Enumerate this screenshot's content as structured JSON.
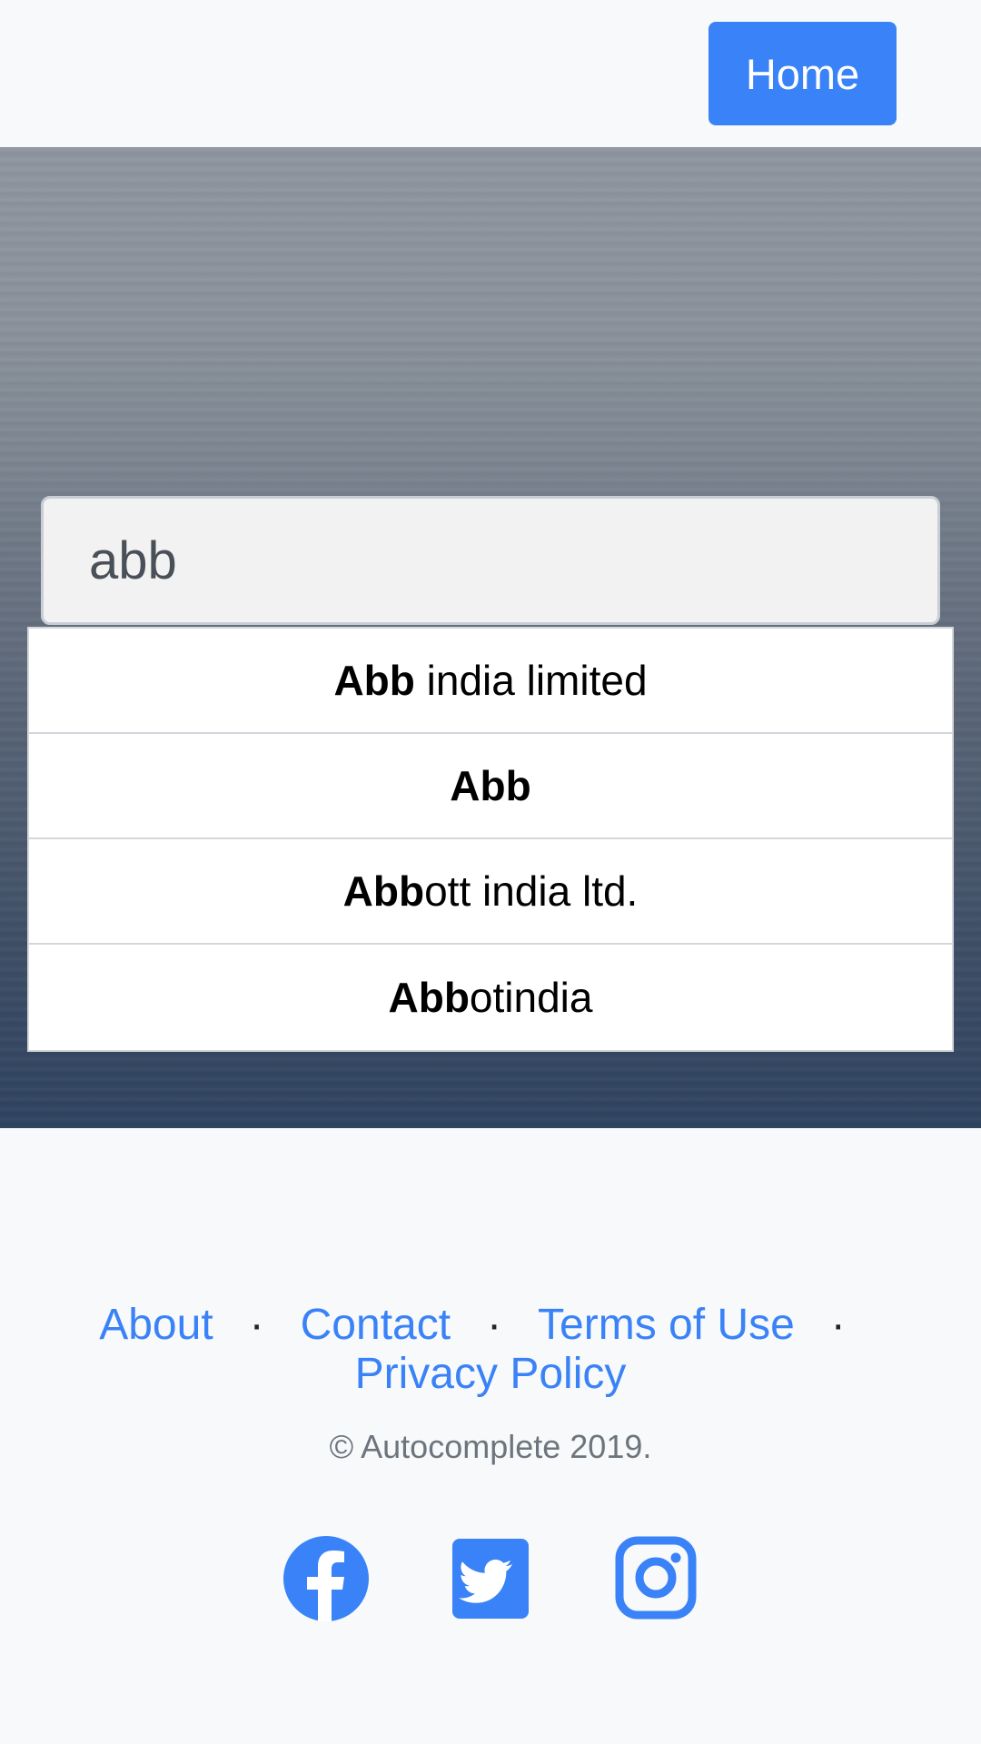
{
  "navbar": {
    "home_label": "Home"
  },
  "search": {
    "value": "abb",
    "placeholder": ""
  },
  "suggestions": [
    {
      "match": "Abb",
      "rest": " india limited"
    },
    {
      "match": "Abb",
      "rest": ""
    },
    {
      "match": "Abb",
      "rest": "ott india ltd."
    },
    {
      "match": "Abb",
      "rest": "otindia"
    }
  ],
  "footer": {
    "links": {
      "about": "About",
      "contact": "Contact",
      "terms": "Terms of Use",
      "privacy": "Privacy Policy"
    },
    "separator": "·",
    "copyright": "© Autocomplete 2019."
  },
  "social": {
    "icons": [
      "facebook-icon",
      "twitter-icon",
      "instagram-icon"
    ],
    "color": "#3a82f7"
  },
  "colors": {
    "accent": "#3a82f7",
    "page_background": "#f8f9fa"
  }
}
